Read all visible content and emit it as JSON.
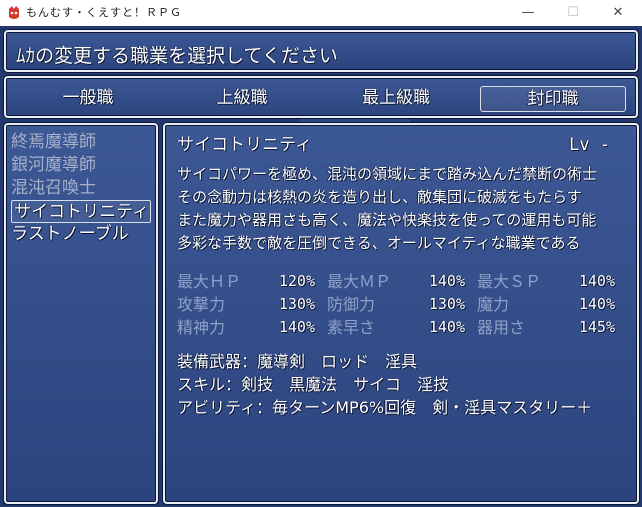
{
  "window": {
    "title": "もんむす・くえすと！ＲＰＧ",
    "min_glyph": "—",
    "max_glyph": "☐",
    "close_glyph": "✕"
  },
  "header": {
    "prompt": "ﾑｶの変更する職業を選択してください"
  },
  "tabs": [
    {
      "label": "一般職",
      "active": false
    },
    {
      "label": "上級職",
      "active": false
    },
    {
      "label": "最上級職",
      "active": false
    },
    {
      "label": "封印職",
      "active": true
    }
  ],
  "job_list": [
    {
      "label": "終焉魔導師",
      "dim": true
    },
    {
      "label": "銀河魔導師",
      "dim": true
    },
    {
      "label": "混沌召喚士",
      "dim": true
    },
    {
      "label": "サイコトリニティ",
      "dim": false,
      "selected": true
    },
    {
      "label": "ラストノーブル",
      "dim": false
    }
  ],
  "detail": {
    "name": "サイコトリニティ",
    "level": "Lv  -",
    "description": [
      "サイコパワーを極め、混沌の領域にまで踏み込んだ禁断の術士",
      "その念動力は核熱の炎を造り出し、敵集団に破滅をもたらす",
      "また魔力や器用さも高く、魔法や快楽技を使っての運用も可能",
      "多彩な手数で敵を圧倒できる、オールマイティな職業である"
    ],
    "stats": [
      [
        {
          "label": "最大ＨＰ",
          "value": "120%"
        },
        {
          "label": "最大ＭＰ",
          "value": "140%"
        },
        {
          "label": "最大ＳＰ",
          "value": "140%"
        }
      ],
      [
        {
          "label": "攻撃力",
          "value": "130%"
        },
        {
          "label": "防御力",
          "value": "130%"
        },
        {
          "label": "魔力",
          "value": "140%"
        }
      ],
      [
        {
          "label": "精神力",
          "value": "140%"
        },
        {
          "label": "素早さ",
          "value": "140%"
        },
        {
          "label": "器用さ",
          "value": "145%"
        }
      ]
    ],
    "equipment": "装備武器：魔導剣　ロッド　淫具",
    "skills": "スキル：剣技　黒魔法　サイコ　淫技",
    "abilities": "アビリティ：毎ターンMP6%回復　剣・淫具マスタリー＋"
  }
}
